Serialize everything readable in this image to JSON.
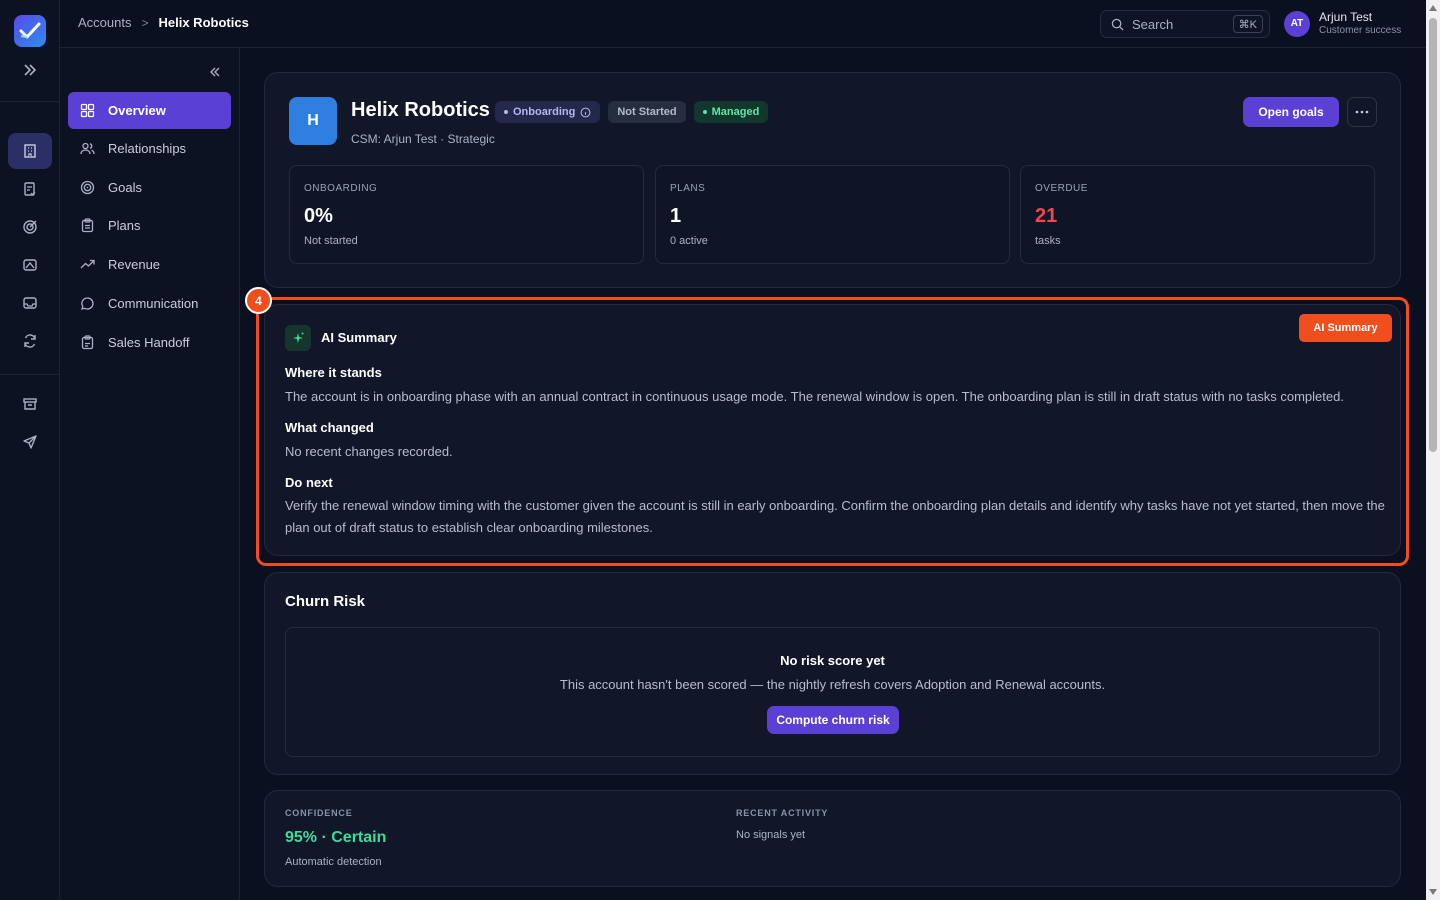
{
  "breadcrumb": {
    "parent": "Accounts",
    "separator": ">",
    "current": "Helix Robotics"
  },
  "search": {
    "label": "Search",
    "shortcut": "⌘K"
  },
  "user": {
    "initials": "AT",
    "name": "Arjun Test",
    "role": "Customer success"
  },
  "subnav": {
    "items": [
      {
        "label": "Overview",
        "icon": "grid-icon",
        "active": true
      },
      {
        "label": "Relationships",
        "icon": "users-icon"
      },
      {
        "label": "Goals",
        "icon": "target-icon"
      },
      {
        "label": "Plans",
        "icon": "clipboard-icon"
      },
      {
        "label": "Revenue",
        "icon": "trend-icon"
      },
      {
        "label": "Communication",
        "icon": "chat-icon"
      },
      {
        "label": "Sales Handoff",
        "icon": "clipboard-check-icon"
      }
    ]
  },
  "account": {
    "logo_letter": "H",
    "name": "Helix Robotics",
    "badges": {
      "onboarding": "Onboarding",
      "status": "Not Started",
      "managed": "Managed"
    },
    "csm_line": "CSM: Arjun Test · Strategic",
    "open_goals_label": "Open goals",
    "more_label": "···"
  },
  "stats": [
    {
      "label": "ONBOARDING",
      "value": "0%",
      "sub": "Not started"
    },
    {
      "label": "PLANS",
      "value": "1",
      "sub": "0 active"
    },
    {
      "label": "OVERDUE",
      "value": "21",
      "sub": "tasks"
    }
  ],
  "ai_summary": {
    "title": "AI Summary",
    "sections": [
      {
        "heading": "Where it stands",
        "body": "The account is in onboarding phase with an annual contract in continuous usage mode. The renewal window is open. The onboarding plan is still in draft status with no tasks completed."
      },
      {
        "heading": "What changed",
        "body": "No recent changes recorded."
      },
      {
        "heading": "Do next",
        "body": "Verify the renewal window timing with the customer given the account is still in early onboarding. Confirm the onboarding plan details and identify why tasks have not yet started, then move the plan out of draft status to establish clear onboarding milestones."
      }
    ]
  },
  "highlight": {
    "number": "4",
    "tag": "AI Summary",
    "color": "#f04e1c"
  },
  "churn": {
    "title": "Churn Risk",
    "empty_title": "No risk score yet",
    "empty_desc": "This account hasn't been scored — the nightly refresh covers Adoption and Renewal accounts.",
    "button": "Compute churn risk"
  },
  "confidence": {
    "label": "CONFIDENCE",
    "value": "95% · Certain",
    "sub": "Automatic detection",
    "activity_label": "RECENT ACTIVITY",
    "activity_value": "No signals yet"
  },
  "colors": {
    "accent": "#5b40d6",
    "overdue": "#f0474b",
    "confidence": "#3ddc97"
  }
}
